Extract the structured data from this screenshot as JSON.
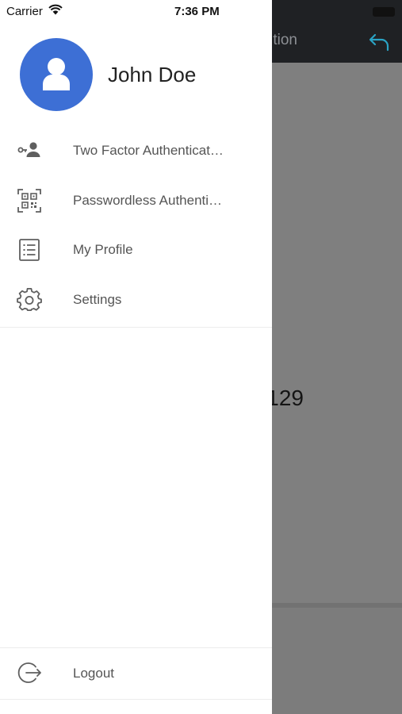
{
  "status_bar": {
    "carrier": "Carrier",
    "time": "7:36 PM"
  },
  "background_screen": {
    "title_fragment": "tion",
    "value_fragment": "129",
    "accent_color": "#2aa3c4"
  },
  "drawer": {
    "user": {
      "name": "John Doe",
      "avatar_color": "#3d6fd5",
      "avatar_icon": "person-icon"
    },
    "items": [
      {
        "label": "Two Factor Authentication",
        "icon": "key-user-icon"
      },
      {
        "label": "Passwordless Authentication",
        "icon": "qr-code-icon"
      },
      {
        "label": "My Profile",
        "icon": "list-document-icon"
      },
      {
        "label": "Settings",
        "icon": "gear-icon"
      }
    ],
    "logout": {
      "label": "Logout",
      "icon": "logout-icon"
    }
  }
}
